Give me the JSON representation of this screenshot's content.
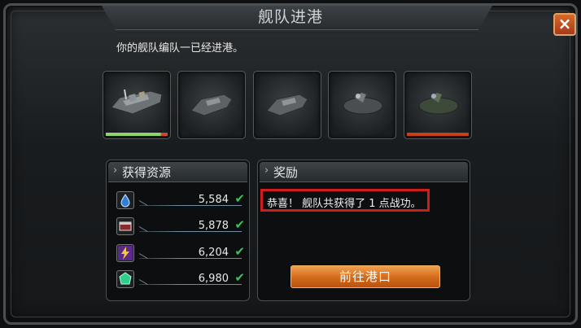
{
  "dialog": {
    "title": "舰队进港",
    "close_label": "×"
  },
  "message": "你的舰队编队一已经进港。",
  "ships": [
    {
      "icon": "battleship-icon",
      "hp_fraction": 1.0,
      "hp_colors": [
        "#8fd36e",
        "#c84a28"
      ]
    },
    {
      "icon": "gunboat-icon",
      "hp_fraction": 0
    },
    {
      "icon": "gunboat-icon",
      "hp_fraction": 0
    },
    {
      "icon": "submarine-icon",
      "hp_fraction": 0
    },
    {
      "icon": "submarine-camo-icon",
      "hp_fraction": 1.0,
      "hp_colors": [
        "#c8401a",
        "#c8401a"
      ]
    }
  ],
  "resources_panel": {
    "title": "获得资源",
    "items": [
      {
        "icon": "oil-drop-icon",
        "value": "5,584"
      },
      {
        "icon": "steel-icon",
        "value": "5,878"
      },
      {
        "icon": "energy-bolt-icon",
        "value": "6,204"
      },
      {
        "icon": "crystal-icon",
        "value": "6,980"
      }
    ]
  },
  "reward_panel": {
    "title": "奖励",
    "text": "恭喜！ 舰队共获得了 1 点战功。"
  },
  "goto_port_button": "前往港口",
  "colors": {
    "accent": "#d26a1a",
    "highlight_border": "#cf1c1c",
    "check": "#3fc058"
  }
}
